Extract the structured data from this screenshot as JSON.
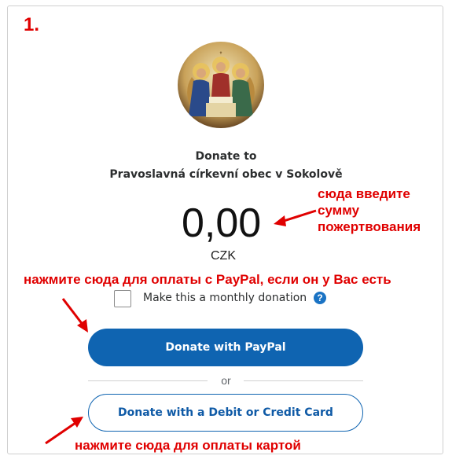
{
  "step_number": "1.",
  "header": {
    "donate_to": "Donate to",
    "org_name": "Pravoslavná církevní obec v Sokolově"
  },
  "amount": {
    "value": "0,00",
    "currency": "CZK"
  },
  "annotations": {
    "amount_hint": [
      "сюда введите",
      "сумму",
      "пожертвования"
    ],
    "paypal_hint": "нажмите сюда для оплаты с PayPal, если он у Вас есть",
    "card_hint": "нажмите сюда для оплаты картой"
  },
  "monthly": {
    "label": "Make this a monthly donation",
    "checked": false,
    "help_icon": "question-circle-icon"
  },
  "buttons": {
    "paypal_label": "Donate with PayPal",
    "separator": "or",
    "card_label": "Donate with a Debit or Credit Card"
  },
  "colors": {
    "annotation_red": "#e00000",
    "paypal_blue": "#0f64b1"
  }
}
